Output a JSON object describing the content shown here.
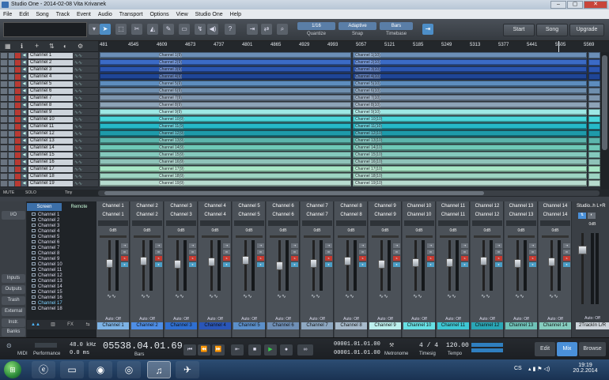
{
  "window": {
    "title": "Studio One - 2014-02-08 Vita Krivanek",
    "controls": [
      "–",
      "▢",
      "✕"
    ]
  },
  "menu": [
    "File",
    "Edit",
    "Song",
    "Track",
    "Event",
    "Audio",
    "Transport",
    "Options",
    "View",
    "Studio One",
    "Help"
  ],
  "toolbar": {
    "quantize": {
      "value": "1/16",
      "label": "Quantize"
    },
    "snap": {
      "value": "Adaptive",
      "label": "Snap"
    },
    "timebase": {
      "value": "Bars",
      "label": "Timebase"
    },
    "start": "Start",
    "song": "Song",
    "upgrade": "Upgrade"
  },
  "ruler": [
    "481",
    "4545",
    "4609",
    "4673",
    "4737",
    "4801",
    "4865",
    "4929",
    "4993",
    "5057",
    "5121",
    "5185",
    "5249",
    "5313",
    "5377",
    "5441",
    "5505",
    "5569"
  ],
  "tracks": [
    {
      "name": "Channel 1",
      "clip_a": "Channel 1(9)",
      "clip_b": "Channel 1(10)",
      "color": "#6b8fb8"
    },
    {
      "name": "Channel 2",
      "clip_a": "Channel 2(9)",
      "clip_b": "Channel 2(10)",
      "color": "#3b6bc6"
    },
    {
      "name": "Channel 3",
      "clip_a": "Channel 3(9)",
      "clip_b": "Channel 3(10)",
      "color": "#2a55b0"
    },
    {
      "name": "Channel 4",
      "clip_a": "Channel 4(9)",
      "clip_b": "Channel 4(10)",
      "color": "#1f4596"
    },
    {
      "name": "Channel 5",
      "clip_a": "Channel 5(9)",
      "clip_b": "Channel 5(10)",
      "color": "#5d8dbe"
    },
    {
      "name": "Channel 6",
      "clip_a": "Channel 6(9)",
      "clip_b": "Channel 6(10)",
      "color": "#6f8fae"
    },
    {
      "name": "Channel 7",
      "clip_a": "Channel 7(9)",
      "clip_b": "Channel 7(10)",
      "color": "#7e96ae"
    },
    {
      "name": "Channel 8",
      "clip_a": "Channel 8(9)",
      "clip_b": "Channel 8(10)",
      "color": "#8ea4b8"
    },
    {
      "name": "Channel 9",
      "clip_a": "Channel 9(9)",
      "clip_b": "Channel 9(10)",
      "color": "#9ee8e5"
    },
    {
      "name": "Channel 10",
      "clip_a": "Channel 10(9)",
      "clip_b": "Channel 10(10)",
      "color": "#4ad6db"
    },
    {
      "name": "Channel 11",
      "clip_a": "Channel 11(9)",
      "clip_b": "Channel 11(10)",
      "color": "#26b9c8"
    },
    {
      "name": "Channel 12",
      "clip_a": "Channel 12(9)",
      "clip_b": "Channel 12(10)",
      "color": "#1e9aaa"
    },
    {
      "name": "Channel 13",
      "clip_a": "Channel 13(9)",
      "clip_b": "Channel 13(10)",
      "color": "#5cb5ac"
    },
    {
      "name": "Channel 14",
      "clip_a": "Channel 14(9)",
      "clip_b": "Channel 14(10)",
      "color": "#6fc8b7"
    },
    {
      "name": "Channel 15",
      "clip_a": "Channel 15(9)",
      "clip_b": "Channel 15(10)",
      "color": "#84c9bd"
    },
    {
      "name": "Channel 16",
      "clip_a": "Channel 16(9)",
      "clip_b": "Channel 16(10)",
      "color": "#8fc3b9"
    },
    {
      "name": "Channel 17",
      "clip_a": "Channel 17(9)",
      "clip_b": "Channel 17(10)",
      "color": "#a6e6c6"
    },
    {
      "name": "Channel 18",
      "clip_a": "Channel 18(9)",
      "clip_b": "Channel 18(10)",
      "color": "#9ed5c3"
    },
    {
      "name": "Channel 19",
      "clip_a": "Channel 19(9)",
      "clip_b": "Channel 19(10)",
      "color": "#b7dccf"
    }
  ],
  "trackfoot": {
    "mute": "MUTE",
    "solo": "SOLO",
    "size": "Tiny"
  },
  "mixer_left": [
    "I/O",
    "Inputs",
    "Outputs",
    "Trash",
    "External",
    "Instr.",
    "Banks"
  ],
  "mixer_list": {
    "tab_screen": "Screen",
    "tab_remote": "Remote",
    "items": [
      "Channel 1",
      "Channel 2",
      "Channel 3",
      "Channel 4",
      "Channel 5",
      "Channel 6",
      "Channel 7",
      "Channel 8",
      "Channel 9",
      "Channel 10",
      "Channel 11",
      "Channel 12",
      "Channel 13",
      "Channel 14",
      "Channel 15",
      "Channel 16",
      "Channel 17",
      "Channel 18"
    ],
    "bottom": [
      "",
      "",
      ""
    ]
  },
  "channels": [
    {
      "hdr": "Channel 1",
      "hdr2": "Channel 1",
      "name": "Channel 1",
      "color": "#7db3e6",
      "fader": 0.55
    },
    {
      "hdr": "Channel 2",
      "hdr2": "Channel 2",
      "name": "Channel 2",
      "color": "#4e8ee6",
      "fader": 0.6
    },
    {
      "hdr": "Channel 3",
      "hdr2": "Channel 3",
      "name": "Channel 3",
      "color": "#2f6fd1",
      "fader": 0.52
    },
    {
      "hdr": "Channel 4",
      "hdr2": "Channel 4",
      "name": "Channel 4",
      "color": "#2a56b8",
      "fader": 0.58
    },
    {
      "hdr": "Channel 5",
      "hdr2": "Channel 5",
      "name": "Channel 5",
      "color": "#5b8fc9",
      "fader": 0.62
    },
    {
      "hdr": "Channel 6",
      "hdr2": "Channel 6",
      "name": "Channel 6",
      "color": "#6f8fb6",
      "fader": 0.5
    },
    {
      "hdr": "Channel 7",
      "hdr2": "Channel 7",
      "name": "Channel 7",
      "color": "#8ea8c2",
      "fader": 0.55
    },
    {
      "hdr": "Channel 8",
      "hdr2": "Channel 8",
      "name": "Channel 8",
      "color": "#a8bbcc",
      "fader": 0.6
    },
    {
      "hdr": "Channel 9",
      "hdr2": "Channel 9",
      "name": "Channel 9",
      "color": "#bdf0ee",
      "fader": 0.53
    },
    {
      "hdr": "Channel 10",
      "hdr2": "Channel 10",
      "name": "Channel 10",
      "color": "#67e0e4",
      "fader": 0.57
    },
    {
      "hdr": "Channel 11",
      "hdr2": "Channel 11",
      "name": "Channel 11",
      "color": "#3ec7d4",
      "fader": 0.56
    },
    {
      "hdr": "Channel 12",
      "hdr2": "Channel 12",
      "name": "Channel 12",
      "color": "#2aa6b6",
      "fader": 0.6
    },
    {
      "hdr": "Channel 13",
      "hdr2": "Channel 13",
      "name": "Channel 13",
      "color": "#6fc2b8",
      "fader": 0.54
    },
    {
      "hdr": "Channel 14",
      "hdr2": "Channel 14",
      "name": "Channel 14",
      "color": "#86cdbf",
      "fader": 0.58
    }
  ],
  "channel_common": {
    "vol": "0dB",
    "auto": "Auto: Off"
  },
  "mixer_right": {
    "title": "Studio..h L+R",
    "vol": "0dB",
    "bus": "",
    "auto": "Auto: Off",
    "name": "2TrackIn L/R"
  },
  "transport": {
    "midi": "MIDI",
    "performance": "Performance",
    "rate": "48.0 kHz",
    "latency": "0.0 ms",
    "position": "05538.04.01.69",
    "pos_unit": "Bars",
    "loop_start": "00001.01.01.00",
    "loop_end": "00001.01.01.00",
    "metronome": "Metronome",
    "timesig_val": "4 / 4",
    "timesig": "Timesig",
    "tempo_val": "120.00",
    "tempo": "Tempo",
    "edit": "Edit",
    "mix": "Mix",
    "browse": "Browse"
  },
  "taskbar": {
    "lang": "CS",
    "time": "19:19",
    "date": "20.2.2014"
  }
}
